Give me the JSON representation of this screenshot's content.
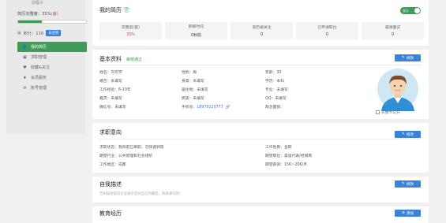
{
  "sidebar": {
    "user_name": "前程子",
    "completion_label": "简历完整度：35%",
    "completion_extra": "(差)",
    "completion_value": 0.35,
    "points_label": "积分：110",
    "points_button": "未签到",
    "menu": [
      {
        "label": "我的简历",
        "icon": "person-icon",
        "active": true
      },
      {
        "label": "求职管理",
        "icon": "briefcase-icon",
        "active": false
      },
      {
        "label": "收藏&关注",
        "icon": "heart-icon",
        "active": false
      },
      {
        "label": "会员服务",
        "icon": "vip-icon",
        "active": false
      },
      {
        "label": "账号管理",
        "icon": "gear-icon",
        "active": false
      }
    ]
  },
  "resume": {
    "title": "我的简历",
    "toggle_label": "显示",
    "stats": [
      {
        "label": "完整度(差)",
        "value": "35%",
        "highlight": true
      },
      {
        "label": "刷新时间",
        "value": "0秒前",
        "highlight": false
      },
      {
        "label": "简历被关注",
        "value": "0",
        "highlight": false
      },
      {
        "label": "已申请职位",
        "value": "0",
        "highlight": false
      },
      {
        "label": "邀请面试",
        "value": "0",
        "highlight": false
      }
    ]
  },
  "basic": {
    "title": "基本资料",
    "audit_status": "审核通过",
    "edit_label": "修改",
    "fields": {
      "name": "姓名：刘可学",
      "gender": "性别：男",
      "age": "年龄：30",
      "marriage": "婚否：未填写",
      "height": "身高：未填写",
      "education": "学历：本科",
      "experience": "工作经验：6-10年",
      "residence": "居住地：未填写",
      "major": "专业：未填写",
      "hometown": "籍贯：未填写",
      "nation": "民族：未填写",
      "qq": "QQ：未填写",
      "wechat": "微信号：未填写",
      "phone_label": "手机号：",
      "phone_value": "18979120777",
      "political": "政治面貌："
    },
    "hide_label": "头像不公开"
  },
  "intent": {
    "title": "求职意向",
    "edit_label": "修改",
    "status": "求职状态：我目前已离职，可快速到岗",
    "job_nature": "工作性质：全职",
    "industry": "期望行业：公共管理和社会组织",
    "position": "期望职位：渠道代表/经销商",
    "location": "工作地区：成都",
    "salary": "期望薪资：15K~20K/月"
  },
  "self_desc": {
    "title": "自我描述",
    "edit_label": "修改",
    "placeholder": "告知描述是向企业展示您对自己的最后，快来填写吧！"
  },
  "education": {
    "title": "教育经历",
    "add_label": "添加"
  },
  "colors": {
    "accent_green": "#3e9c57",
    "accent_blue": "#3b82d9",
    "warning_red": "#e0453a"
  }
}
